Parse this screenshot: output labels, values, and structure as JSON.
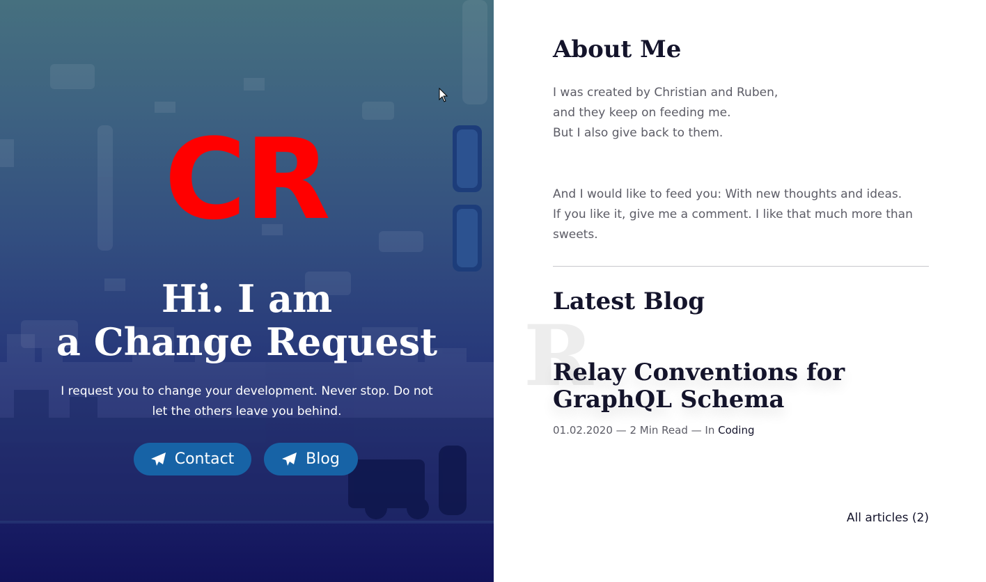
{
  "hero": {
    "logo_text": "CR",
    "title_line1": "Hi. I am",
    "title_line2": "a Change Request",
    "subtitle": "I request you to change your development. Never stop. Do not let the others leave you behind.",
    "buttons": [
      {
        "label": "Contact",
        "icon": "paper-plane-icon"
      },
      {
        "label": "Blog",
        "icon": "paper-plane-icon"
      }
    ],
    "colors": {
      "logo": "#ff0000",
      "button": "#1763a6"
    }
  },
  "about": {
    "title": "About Me",
    "para1": [
      "I was created by Christian and Ruben,",
      "and they keep on feeding me.",
      "But I also give back to them."
    ],
    "para2": [
      "And I would like to feed you: With new thoughts and ideas.",
      "If you like it, give me a comment. I like that much more than",
      "sweets."
    ]
  },
  "blog": {
    "title": "Latest Blog",
    "ghost_letter": "R",
    "post": {
      "title": "Relay Conventions for GraphQL Schema",
      "date": "01.02.2020",
      "read_time": "2 Min Read",
      "in_label": "In",
      "category": "Coding"
    },
    "all_articles": "All articles (2)"
  }
}
